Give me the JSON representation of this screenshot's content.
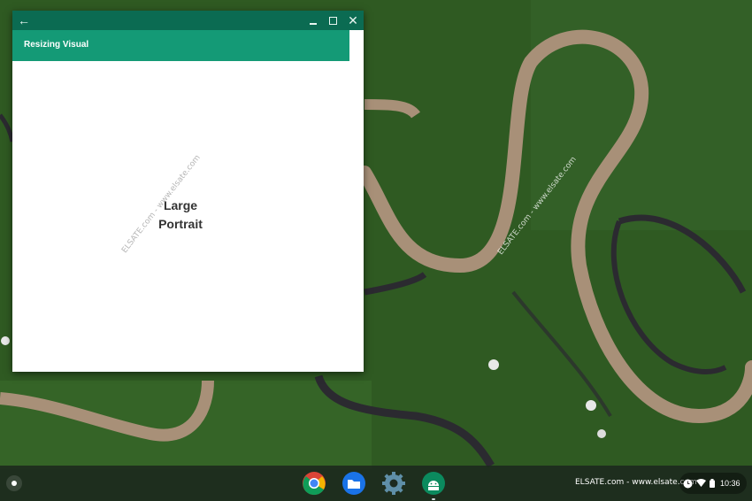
{
  "window": {
    "back_icon": "arrow-back-icon",
    "minimize_icon": "minimize-icon",
    "maximize_icon": "maximize-icon",
    "close_icon": "close-icon",
    "back_glyph": "←",
    "close_glyph": "✕"
  },
  "app": {
    "title": "Resizing Visual",
    "size_label_line1": "Large",
    "size_label_line2": "Portrait"
  },
  "watermark": {
    "diagonal_text": "ELSATE.com - www.elsate.com",
    "shelf_text": "ELSATE.com - www.elsate.com"
  },
  "shelf": {
    "apps": [
      {
        "name": "Chrome",
        "icon": "chrome-icon"
      },
      {
        "name": "Files",
        "icon": "files-icon"
      },
      {
        "name": "Settings",
        "icon": "settings-gear-icon"
      },
      {
        "name": "Android Studio",
        "icon": "android-icon"
      }
    ]
  },
  "status": {
    "clock": "10:36",
    "icons": [
      "notification-icon",
      "wifi-icon",
      "battery-icon"
    ]
  },
  "colors": {
    "caption_bar": "#0b6b52",
    "toolbar": "#149a76",
    "forest": "#2f5a22",
    "river": "#a89078"
  }
}
